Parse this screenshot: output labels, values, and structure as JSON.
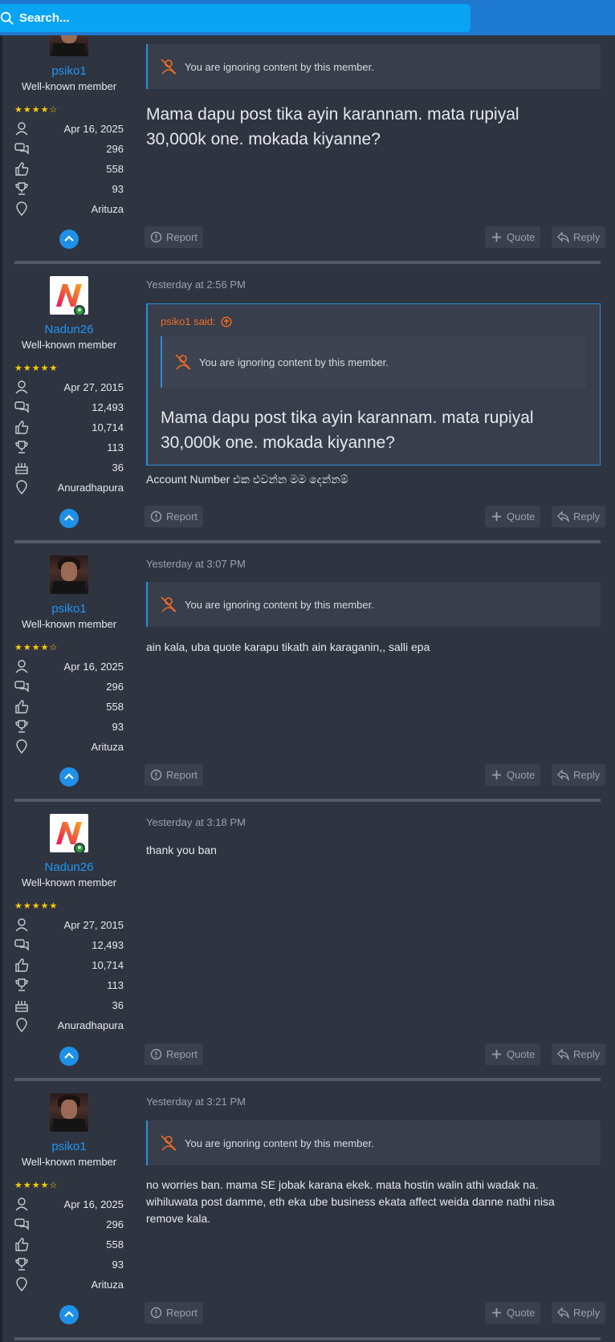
{
  "search": {
    "placeholder": "Search..."
  },
  "actions": {
    "report": "Report",
    "quote": "Quote",
    "reply": "Reply"
  },
  "ignore_notice": "You are ignoring content by this member.",
  "colors": {
    "username": "#2196f3",
    "accent": "#2a8fe0",
    "quote_author": "#f26c22",
    "star": "#ffcb05",
    "background": "#2f3441"
  },
  "users": {
    "psiko1": {
      "name": "psiko1",
      "title": "Well-known member",
      "rating": 4.5,
      "joined": "Apr 16, 2025",
      "messages": "296",
      "reactions": "558",
      "points": "93",
      "location": "Arituza"
    },
    "nadun26": {
      "name": "Nadun26",
      "title": "Well-known member",
      "rating": 5,
      "joined": "Apr 27, 2015",
      "messages": "12,493",
      "reactions": "10,714",
      "points": "113",
      "age": "36",
      "location": "Anuradhapura"
    }
  },
  "posts": [
    {
      "author": "psiko1",
      "date": "",
      "message": "Mama dapu post tika ayin karannam. mata rupiyal 30,000k one. mokada kiyanne?"
    },
    {
      "author": "Nadun26",
      "date": "Yesterday at 2:56 PM",
      "quote_author": "psiko1 said:",
      "quote_text": "Mama dapu post tika ayin karannam. mata rupiyal 30,000k one. mokada kiyanne?",
      "message": "Account Number එක එවන්න මම දෙන්නම්"
    },
    {
      "author": "psiko1",
      "date": "Yesterday at 3:07 PM",
      "message": "ain kala, uba quote karapu tikath ain karaganin,, salli epa"
    },
    {
      "author": "Nadun26",
      "date": "Yesterday at 3:18 PM",
      "message": "thank you ban"
    },
    {
      "author": "psiko1",
      "date": "Yesterday at 3:21 PM",
      "message_lines": [
        "no worries ban. mama SE jobak karana ekek. mata hostin walin athi wadak na.",
        "wihiluwata post damme, eth eka ube business ekata affect weida danne nathi nisa",
        "remove kala."
      ]
    }
  ]
}
